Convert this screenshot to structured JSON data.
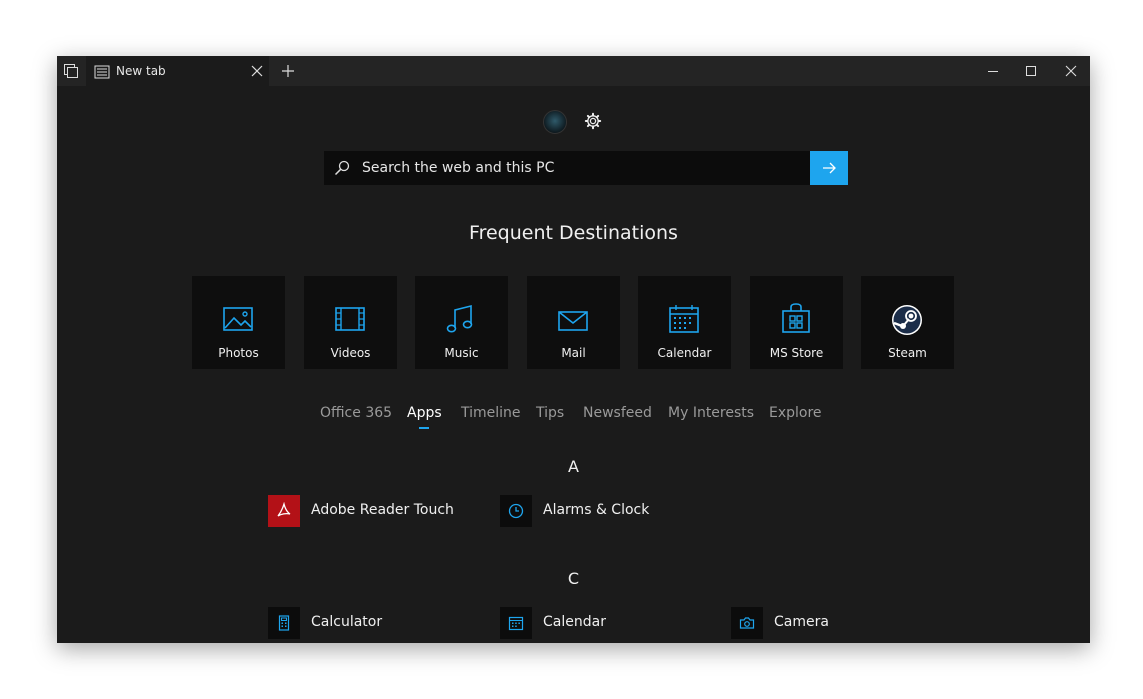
{
  "tab": {
    "title": "New tab"
  },
  "search": {
    "placeholder": "Search the web and this PC"
  },
  "frequent": {
    "title": "Frequent Destinations",
    "tiles": [
      {
        "label": "Photos",
        "icon": "photos-icon"
      },
      {
        "label": "Videos",
        "icon": "videos-icon"
      },
      {
        "label": "Music",
        "icon": "music-icon"
      },
      {
        "label": "Mail",
        "icon": "mail-icon"
      },
      {
        "label": "Calendar",
        "icon": "calendar-icon"
      },
      {
        "label": "MS Store",
        "icon": "store-icon"
      },
      {
        "label": "Steam",
        "icon": "steam-icon"
      }
    ]
  },
  "pivots": {
    "items": [
      "Office 365",
      "Apps",
      "Timeline",
      "Tips",
      "Newsfeed",
      "My Interests",
      "Explore"
    ],
    "active": "Apps"
  },
  "apps": {
    "groups": [
      {
        "letter": "A",
        "items": [
          "Adobe Reader Touch",
          "Alarms & Clock"
        ]
      },
      {
        "letter": "C",
        "items": [
          "Calculator",
          "Calendar",
          "Camera"
        ]
      }
    ]
  },
  "colors": {
    "accent": "#1ea5ee",
    "background": "#1b1b1b",
    "tile": "#0e0e0e",
    "adobe_red": "#b31117"
  }
}
